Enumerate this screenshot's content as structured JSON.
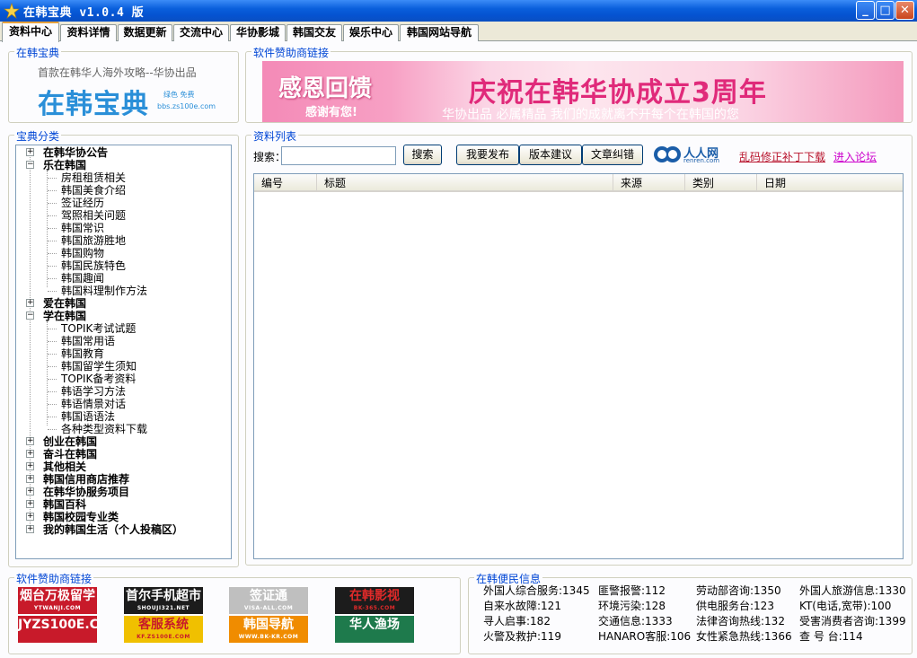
{
  "window": {
    "title": "在韩宝典 v1.0.4 版",
    "min": "_",
    "max": "□",
    "close": "✕"
  },
  "tabs": [
    {
      "label": "资料中心"
    },
    {
      "label": "资料详情"
    },
    {
      "label": "数据更新"
    },
    {
      "label": "交流中心"
    },
    {
      "label": "华协影城"
    },
    {
      "label": "韩国交友"
    },
    {
      "label": "娱乐中心"
    },
    {
      "label": "韩国网站导航"
    }
  ],
  "about_group": {
    "legend": "在韩宝典",
    "tagline": "首款在韩华人海外攻略--华协出品",
    "logo_text": "在韩宝典",
    "logo_small": "绿色 免费",
    "logo_url": "bbs.zs100e.com"
  },
  "banner_group": {
    "legend": "软件赞助商链接",
    "left_text": "感恩回馈",
    "left_sub": "感谢有您!",
    "main_text": "庆祝在韩华协成立3周年",
    "sub_text": "华协出品 必属精品 我们的成就离不开每个在韩国的您"
  },
  "category_group": {
    "legend": "宝典分类",
    "tree": [
      {
        "label": "在韩华协公告",
        "level": 0,
        "expander": "+"
      },
      {
        "label": "乐在韩国",
        "level": 0,
        "expander": "−"
      },
      {
        "label": "房租租赁相关",
        "level": 1
      },
      {
        "label": "韩国美食介绍",
        "level": 1
      },
      {
        "label": "签证经历",
        "level": 1
      },
      {
        "label": "驾照相关问题",
        "level": 1
      },
      {
        "label": "韩国常识",
        "level": 1
      },
      {
        "label": "韩国旅游胜地",
        "level": 1
      },
      {
        "label": "韩国购物",
        "level": 1
      },
      {
        "label": "韩国民族特色",
        "level": 1
      },
      {
        "label": "韩国趣闻",
        "level": 1
      },
      {
        "label": "韩国料理制作方法",
        "level": 1
      },
      {
        "label": "爱在韩国",
        "level": 0,
        "expander": "+"
      },
      {
        "label": "学在韩国",
        "level": 0,
        "expander": "−"
      },
      {
        "label": "TOPIK考试试题",
        "level": 1
      },
      {
        "label": "韩国常用语",
        "level": 1
      },
      {
        "label": "韩国教育",
        "level": 1
      },
      {
        "label": "韩国留学生须知",
        "level": 1
      },
      {
        "label": "TOPIK备考资料",
        "level": 1
      },
      {
        "label": "韩语学习方法",
        "level": 1
      },
      {
        "label": "韩语情景对话",
        "level": 1
      },
      {
        "label": "韩国语语法",
        "level": 1
      },
      {
        "label": "各种类型资料下载",
        "level": 1
      },
      {
        "label": "创业在韩国",
        "level": 0,
        "expander": "+"
      },
      {
        "label": "奋斗在韩国",
        "level": 0,
        "expander": "+"
      },
      {
        "label": "其他相关",
        "level": 0,
        "expander": "+"
      },
      {
        "label": "韩国信用商店推荐",
        "level": 0,
        "expander": "+"
      },
      {
        "label": "在韩华协服务项目",
        "level": 0,
        "expander": "+"
      },
      {
        "label": "韩国百科",
        "level": 0,
        "expander": "+"
      },
      {
        "label": "韩国校园专业类",
        "level": 0,
        "expander": "+"
      },
      {
        "label": "我的韩国生活（个人投稿区）",
        "level": 0,
        "expander": "+"
      }
    ]
  },
  "list_group": {
    "legend": "资料列表",
    "search_label": "搜索：",
    "search_value": "",
    "search_button": "搜索",
    "publish_button": "我要发布",
    "suggest_button": "版本建议",
    "correct_button": "文章纠错",
    "renren_text": "人人网",
    "renren_url": "renren.com",
    "patch_link": "乱码修正补丁下载",
    "forum_link": "进入论坛",
    "columns": [
      "编号",
      "标题",
      "来源",
      "类别",
      "日期"
    ],
    "rows": []
  },
  "sponsors_group": {
    "legend": "软件赞助商链接",
    "items": [
      {
        "title": "烟台万极留学",
        "url": "YTWANJI.COM",
        "bg": "#c81a2a",
        "fg": "#ffffff"
      },
      {
        "title": "JYZS100E.COM",
        "url": "",
        "bg": "#c81a2a",
        "fg": "#ffffff"
      },
      {
        "title": "首尔手机超市",
        "url": "SHOUJI321.NET",
        "bg": "#1c1c1c",
        "fg": "#ffffff"
      },
      {
        "title": "客服系统",
        "url": "KF.ZS100E.COM",
        "bg": "#f0c000",
        "fg": "#c81a2a"
      },
      {
        "title": "签证通",
        "url": "VISA-ALL.COM",
        "bg": "#bfbfbf",
        "fg": "#ffffff"
      },
      {
        "title": "韩国导航",
        "url": "WWW.BK-KR.COM",
        "bg": "#f08c00",
        "fg": "#ffffff"
      },
      {
        "title": "在韩影视",
        "url": "BK-365.COM",
        "bg": "#1c1c1c",
        "fg": "#e02a2a"
      },
      {
        "title": "华人渔场",
        "url": "",
        "bg": "#1e7a4c",
        "fg": "#ffffff"
      }
    ]
  },
  "hotline_group": {
    "legend": "在韩便民信息",
    "items": [
      "外国人综合服务:1345",
      "匪警报警:112",
      "劳动部咨询:1350",
      "外国人旅游信息:1330",
      "自来水故障:121",
      "环境污染:128",
      "供电服务台:123",
      "KT(电话,宽带):100",
      "寻人启事:182",
      "交通信息:1333",
      "法律咨询热线:132",
      "受害消费者咨询:1399",
      "火警及救护:119",
      "HANARO客服:106",
      "女性紧急热线:1366",
      "查 号 台:114"
    ]
  },
  "colors": {
    "legend": "#0046d5",
    "titlebar": "#0553d1",
    "banner_pink": "#e02a7a",
    "link_red": "#b8122b",
    "link_purple": "#cc00cc"
  }
}
